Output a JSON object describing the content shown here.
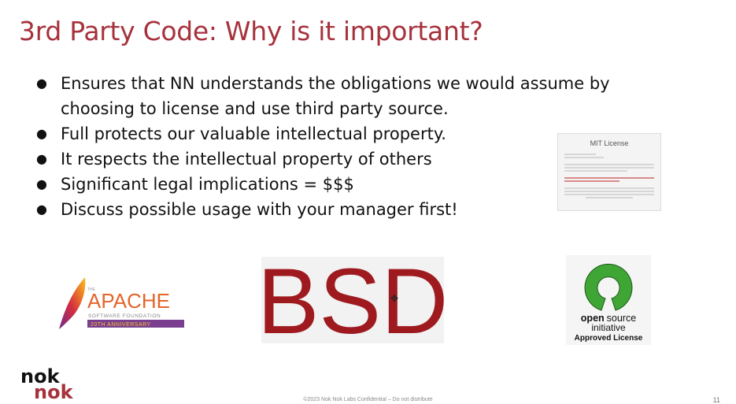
{
  "slide": {
    "title": "3rd Party Code:  Why is it important?",
    "bullets": [
      "Ensures that NN understands the obligations we would assume by choosing to license and use third party source.",
      "Full protects our valuable intellectual property.",
      "It respects the intellectual property of others",
      "Significant legal implications = $$$",
      "Discuss possible usage with your manager first!"
    ],
    "bullet_glyph": "●"
  },
  "mit_license": {
    "title": "MIT License"
  },
  "apache": {
    "the": "THE",
    "name": "APACHE",
    "tagline": "SOFTWARE FOUNDATION",
    "anniversary": "20TH ANNIVERSARY"
  },
  "bsd": {
    "text": "BSD",
    "color": "#9e1a1f"
  },
  "osi": {
    "line1": "open source",
    "line2": "initiative",
    "line3": "Approved License",
    "color": "#3fa535"
  },
  "footer": {
    "confidential": "©2023 Nok Nok Labs Confidential – Do not distribute",
    "page": "11"
  },
  "brand": {
    "line1": "nok",
    "line2": "nok",
    "accent": "#a6323c"
  }
}
